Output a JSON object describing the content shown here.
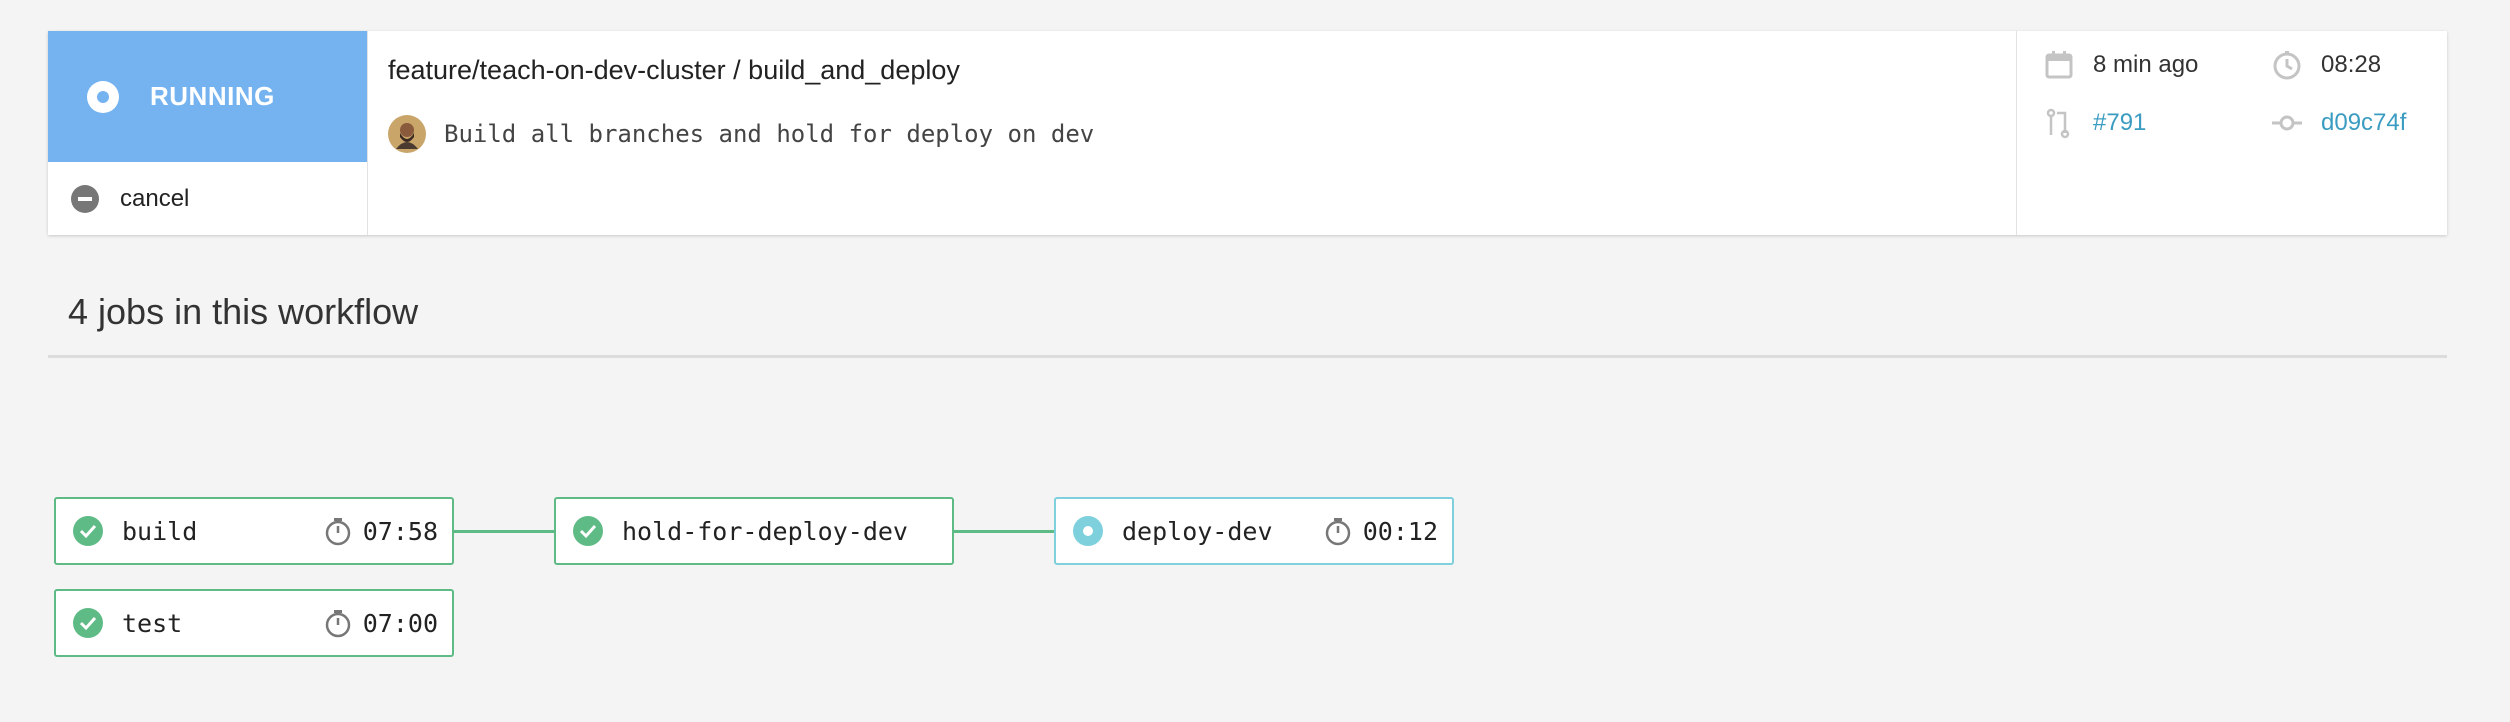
{
  "header": {
    "status_label": "RUNNING",
    "cancel_label": "cancel",
    "workflow_title": "feature/teach-on-dev-cluster / build_and_deploy",
    "commit_message": "Build all branches and hold for deploy on dev",
    "time_ago": "8 min ago",
    "duration": "08:28",
    "pr_number": "#791",
    "commit_hash": "d09c74f"
  },
  "section": {
    "title": "4 jobs in this workflow"
  },
  "jobs": [
    {
      "name": "build",
      "duration": "07:58",
      "status": "success"
    },
    {
      "name": "test",
      "duration": "07:00",
      "status": "success"
    },
    {
      "name": "hold-for-deploy-dev",
      "duration": "",
      "status": "success"
    },
    {
      "name": "deploy-dev",
      "duration": "00:12",
      "status": "running"
    }
  ],
  "colors": {
    "running": "#74b3ef",
    "success": "#5fbb86",
    "running_job": "#7fd0dd",
    "link": "#3b9cc1"
  },
  "icons": {
    "status": "running-dot-icon",
    "cancel": "minus-circle-icon",
    "time_ago": "calendar-icon",
    "duration": "clock-icon",
    "pr": "pull-request-icon",
    "commit": "commit-icon",
    "job_success": "check-circle-icon",
    "job_running": "running-dot-icon",
    "job_timer": "stopwatch-icon"
  }
}
